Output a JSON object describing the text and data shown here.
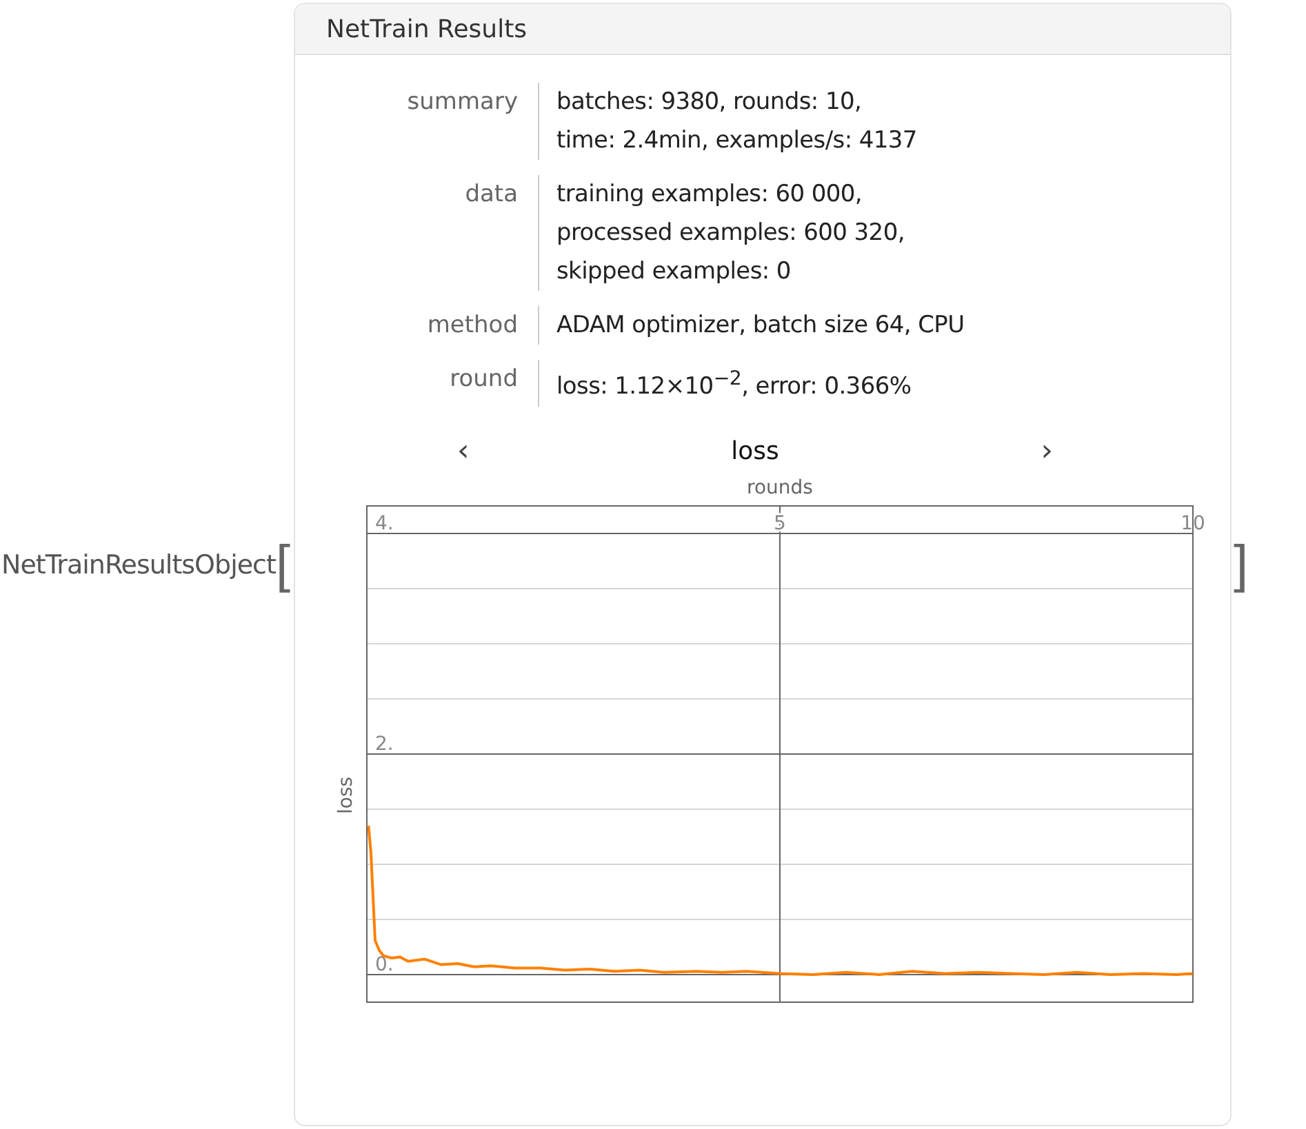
{
  "head": "NetTrainResultsObject",
  "open_bracket": "[",
  "close_bracket": "]",
  "panel": {
    "title": "NetTrain Results",
    "rows": [
      {
        "label": "summary",
        "lines": [
          "batches: 9380, rounds: 10,",
          "time: 2.4min, examples/s: 4137"
        ]
      },
      {
        "label": "data",
        "lines": [
          "training examples: 60 000,",
          "processed examples: 600 320,",
          "skipped examples: 0"
        ]
      },
      {
        "label": "method",
        "lines": [
          "ADAM optimizer, batch size 64, CPU"
        ]
      },
      {
        "label": "round",
        "lines": [
          "loss: 1.12×10$^{−2}$, error: 0.366%"
        ]
      }
    ],
    "nav": {
      "prev": "‹",
      "title": "loss",
      "next": "›"
    },
    "chart_data": {
      "type": "line",
      "grid": true,
      "xlabel": "rounds",
      "ylabel": "loss",
      "xlim": [
        0,
        10
      ],
      "ylim": [
        -0.25,
        4.25
      ],
      "xticks": [
        5,
        10
      ],
      "yticks": [
        {
          "value": 0,
          "label": "0."
        },
        {
          "value": 2,
          "label": "2."
        },
        {
          "value": 4,
          "label": "4."
        }
      ],
      "x": [
        0.02,
        0.05,
        0.1,
        0.15,
        0.2,
        0.3,
        0.4,
        0.5,
        0.7,
        0.9,
        1.1,
        1.3,
        1.5,
        1.8,
        2.1,
        2.4,
        2.7,
        3,
        3.3,
        3.6,
        4,
        4.3,
        4.6,
        5,
        5.4,
        5.8,
        6.2,
        6.6,
        7,
        7.4,
        7.8,
        8.2,
        8.6,
        9,
        9.4,
        9.8,
        10
      ],
      "series": [
        {
          "color": "#ff8000",
          "values": [
            1.35,
            1.1,
            0.31,
            0.22,
            0.17,
            0.15,
            0.16,
            0.12,
            0.14,
            0.09,
            0.1,
            0.07,
            0.08,
            0.06,
            0.06,
            0.04,
            0.05,
            0.03,
            0.04,
            0.02,
            0.03,
            0.02,
            0.03,
            0.01,
            0.0,
            0.02,
            0.0,
            0.03,
            0.01,
            0.02,
            0.01,
            0.0,
            0.02,
            0.0,
            0.01,
            0.0,
            0.01
          ]
        }
      ]
    }
  }
}
